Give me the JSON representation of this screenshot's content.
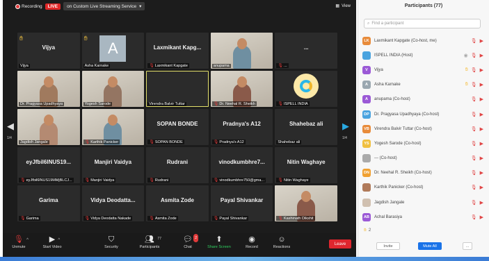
{
  "topbar": {
    "recording": "Recording",
    "live": "LIVE",
    "stream": "on Custom Live Streaming Service",
    "view": "View"
  },
  "tiles": [
    {
      "title": "Vijya",
      "label": "Vijya",
      "hand": true,
      "type": "name",
      "muted": false
    },
    {
      "title": "",
      "label": "Asha Karnake",
      "hand": true,
      "type": "avatar",
      "avatar": "A",
      "muted": false
    },
    {
      "title": "Laxmikant  Kapg...",
      "label": "Laxmikant Kapgate",
      "type": "name",
      "muted": true
    },
    {
      "title": "",
      "label": "anupama",
      "type": "photo",
      "muted": false
    },
    {
      "title": "...",
      "label": "...",
      "type": "name",
      "muted": true
    },
    {
      "title": "",
      "label": "Dr. Pragyasa Upadhyaya",
      "type": "photo",
      "muted": false
    },
    {
      "title": "",
      "label": "Yogesh Sarode",
      "type": "photo",
      "muted": false
    },
    {
      "title": "",
      "label": "Virendra Balvir Tuttar",
      "type": "name",
      "active": true,
      "muted": false
    },
    {
      "title": "",
      "label": "Dr. Neehal R. Sheikh",
      "type": "photo",
      "muted": true
    },
    {
      "title": "",
      "label": "ISPELL INDIA",
      "type": "logo",
      "muted": true
    },
    {
      "title": "",
      "label": "Jagdish Jangale",
      "type": "photo",
      "muted": false
    },
    {
      "title": "",
      "label": "Karthik Panicker",
      "type": "photo",
      "muted": true
    },
    {
      "title": "SOPAN BONDE",
      "label": "SOPAN BONDE",
      "type": "name",
      "muted": true
    },
    {
      "title": "Pradnya's A12",
      "label": "Pradnya's A12",
      "type": "name",
      "muted": true
    },
    {
      "title": "Shahebaz ali",
      "label": "Shahebaz ali",
      "type": "name",
      "muted": false
    },
    {
      "title": "eyJfbil6lNUS19...",
      "label": "eyJfbil6lNUS19MMjBLCJ...",
      "type": "name",
      "muted": true
    },
    {
      "title": "Manjiri Vaidya",
      "label": "Manjiri Vaidya",
      "type": "name",
      "muted": true
    },
    {
      "title": "Rudrani",
      "label": "Rudrani",
      "type": "name",
      "muted": true
    },
    {
      "title": "vinodkumbhre7...",
      "label": "vinodkumbhre750@gma...",
      "type": "name",
      "muted": true
    },
    {
      "title": "Nitin Waghaye",
      "label": "Nitin Waghaye",
      "type": "name",
      "muted": true
    },
    {
      "title": "Garima",
      "label": "Garima",
      "type": "name",
      "muted": true
    },
    {
      "title": "Vidya  Deodatta...",
      "label": "Vidya Deodatta Nakade",
      "type": "name",
      "muted": true
    },
    {
      "title": "Asmita Zode",
      "label": "Asmita Zode",
      "type": "name",
      "muted": true
    },
    {
      "title": "Payal Shivankar",
      "label": "Payal Shivankar",
      "type": "name",
      "muted": true
    },
    {
      "title": "",
      "label": "Kashinath Dikshit",
      "type": "photo",
      "muted": true
    }
  ],
  "pages": {
    "left": "1/4",
    "right": "1/4"
  },
  "toolbar": {
    "unmute": "Unmute",
    "video": "Start Video",
    "security": "Security",
    "participants": "Participants",
    "participants_count": "77",
    "chat": "Chat",
    "chat_badge": "2",
    "share": "Share Screen",
    "record": "Record",
    "reactions": "Reactions",
    "leave": "Leave"
  },
  "panel": {
    "title": "Participants (77)",
    "search_placeholder": "Find a participant",
    "hand_count": "2",
    "invite": "Invite",
    "mute_all": "Mute All",
    "more": "..."
  },
  "participants": [
    {
      "initials": "LK",
      "name": "Laxmikant Kapgate (Co-host, me)",
      "color": "#e88b3a",
      "icons": [
        "mic",
        "cam"
      ]
    },
    {
      "initials": "",
      "name": "ISPELL INDIA (Host)",
      "color": "#4aa3df",
      "icons": [
        "share",
        "mic",
        "cam"
      ]
    },
    {
      "initials": "V",
      "name": "Vijya",
      "color": "#9b59d6",
      "icons": [
        "hand",
        "mic",
        "cam"
      ]
    },
    {
      "initials": "A",
      "name": "Asha Karnake",
      "color": "#9aa7b0",
      "icons": [
        "hand",
        "mic",
        "cam"
      ]
    },
    {
      "initials": "A",
      "name": "anupama (Co-host)",
      "color": "#9b59d6",
      "icons": [
        "mic",
        "cam"
      ]
    },
    {
      "initials": "DP",
      "name": "Dr. Pragyasa Upadhyaya (Co-host)",
      "color": "#4aa3df",
      "icons": [
        "mic",
        "cam"
      ]
    },
    {
      "initials": "VB",
      "name": "Virendra Balvir Tuttar (Co-host)",
      "color": "#e88b3a",
      "icons": [
        "mic",
        "cam"
      ]
    },
    {
      "initials": "YS",
      "name": "Yogesh Sarode (Co-host)",
      "color": "#f0c040",
      "icons": [
        "mic",
        "cam"
      ]
    },
    {
      "initials": "",
      "name": "--- (Co-host)",
      "color": "#aaa",
      "icons": [
        "mic",
        "cam"
      ]
    },
    {
      "initials": "DN",
      "name": "Dr. Neehal R. Sheikh (Co-host)",
      "color": "#f0a030",
      "icons": [
        "mic",
        "cam"
      ]
    },
    {
      "initials": "",
      "name": "Karthik Panicker (Co-host)",
      "color": "#b07a5a",
      "icons": [
        "mic",
        "cam"
      ]
    },
    {
      "initials": "",
      "name": "Jagdish Jangale",
      "color": "#d0c0b0",
      "icons": [
        "mic",
        "cam"
      ]
    },
    {
      "initials": "AB",
      "name": "Achal Barasiya",
      "color": "#9b59d6",
      "icons": [
        "mic",
        "cam"
      ]
    }
  ]
}
